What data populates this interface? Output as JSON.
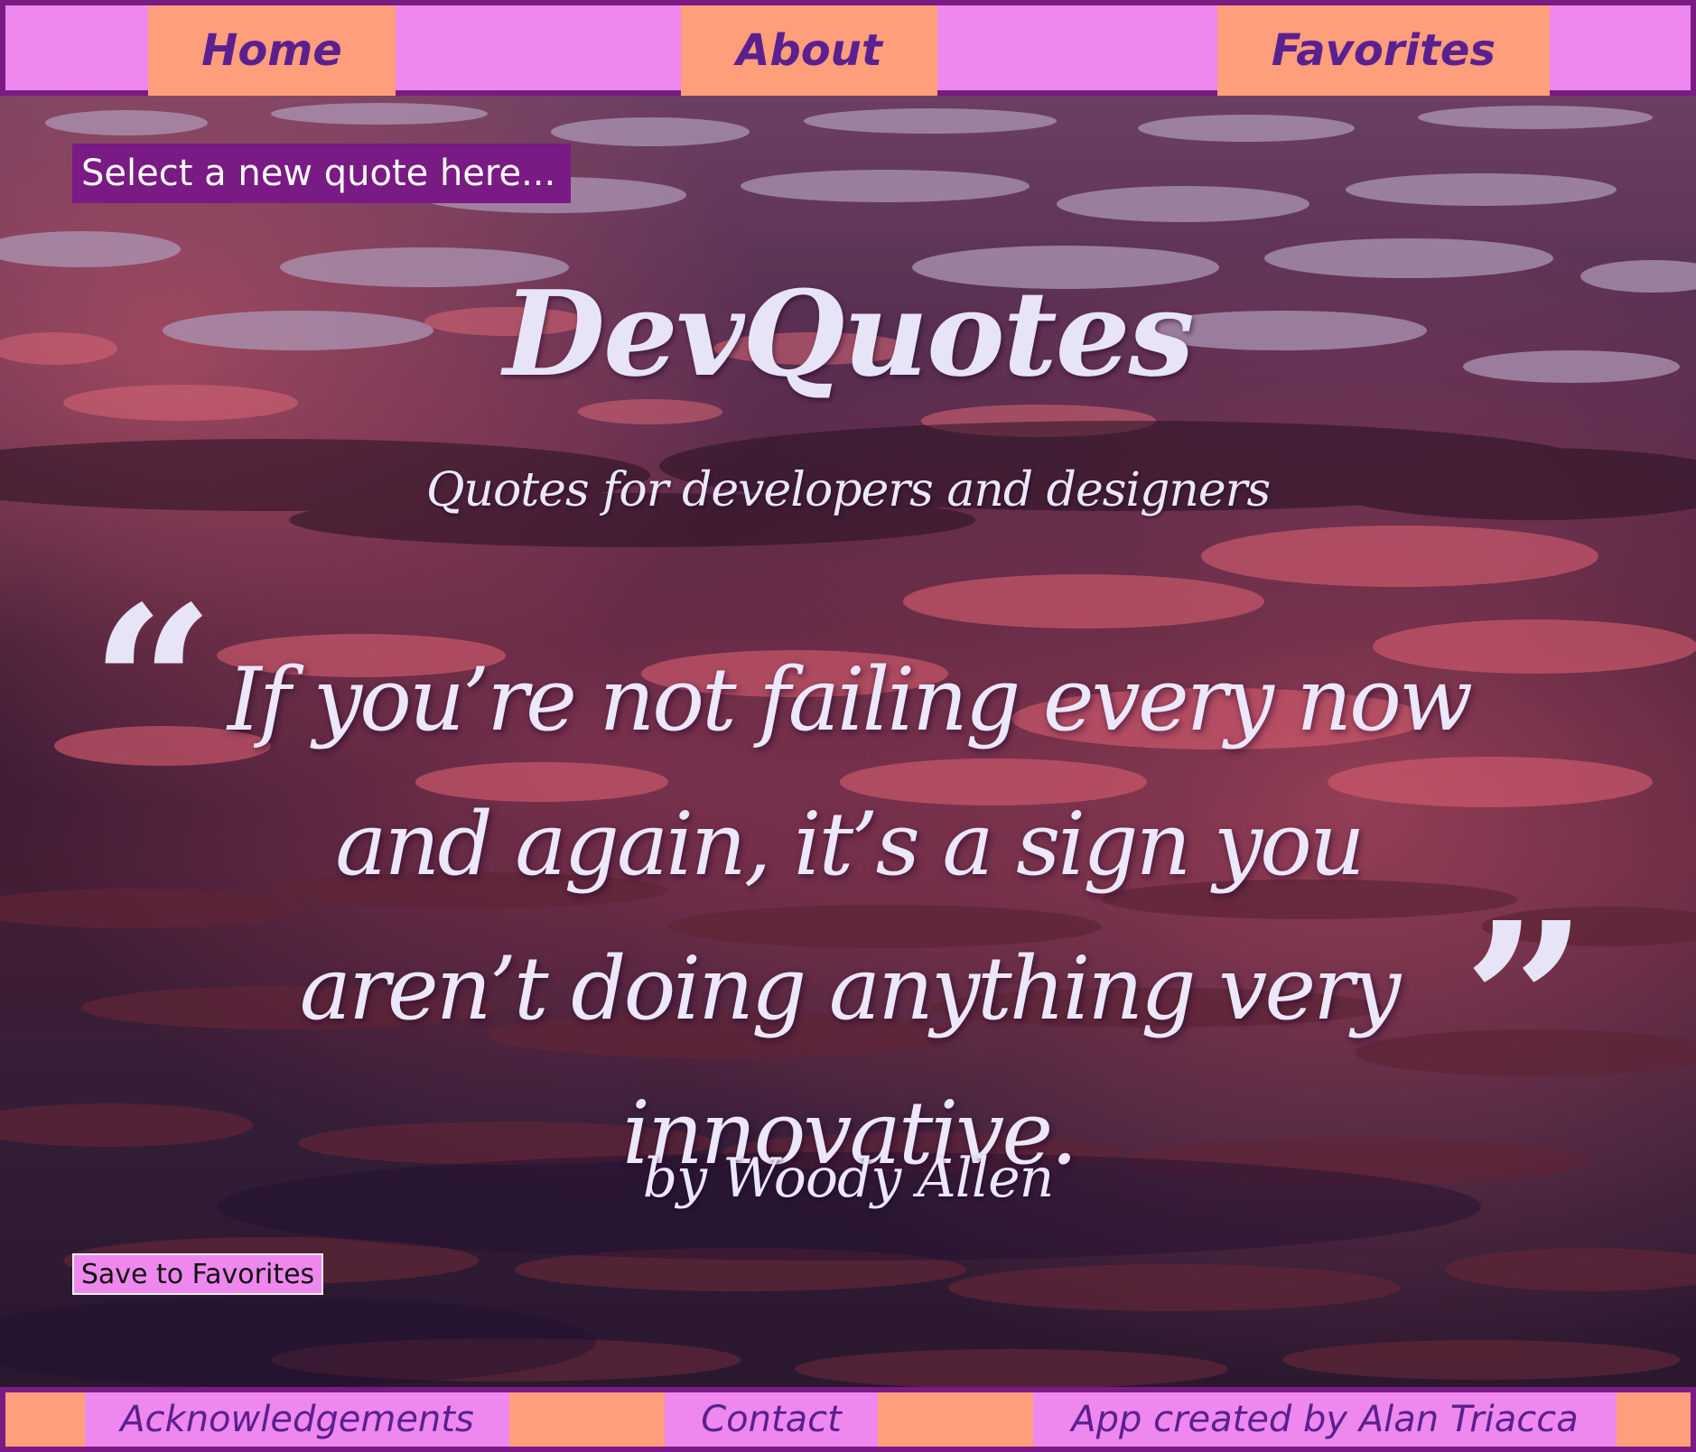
{
  "nav": {
    "home": "Home",
    "about": "About",
    "favorites": "Favorites"
  },
  "select": {
    "label": "Select a new quote here..."
  },
  "header": {
    "title": "DevQuotes",
    "subtitle": "Quotes for developers and designers"
  },
  "quote": {
    "open_mark": "“",
    "close_mark": "”",
    "text": "If you’re not failing every now and again, it’s a sign you aren’t doing anything very innovative.",
    "author": "by Woody Allen"
  },
  "actions": {
    "save": "Save to Favorites"
  },
  "footer": {
    "acknowledgements": "Acknowledgements",
    "contact": "Contact",
    "credit": "App created by Alan Triacca"
  },
  "colors": {
    "nav_bg": "#ee88ee",
    "nav_item_bg": "#ff9e7a",
    "border": "#7a1a84",
    "nav_text": "#5b2090",
    "quote_text": "#ece7fa"
  },
  "background": {
    "description_icon": "sunset-tidal-flats-image"
  }
}
